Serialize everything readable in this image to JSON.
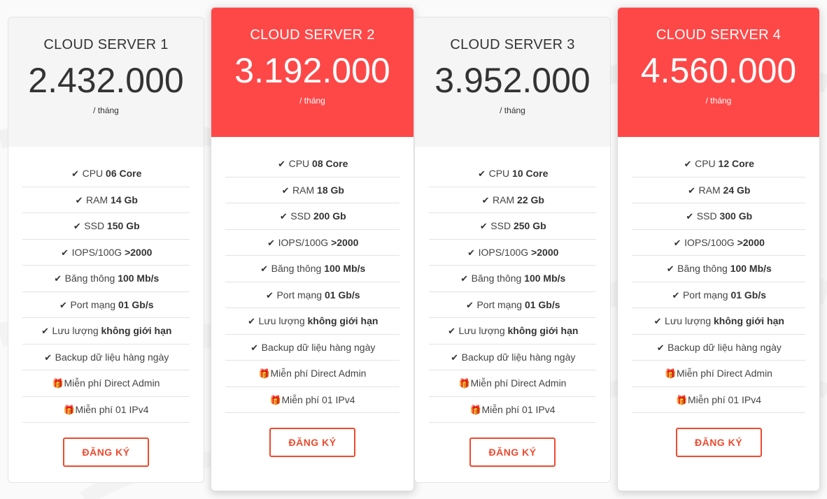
{
  "accent_color": "#fe4848",
  "button_color": "#ee4a2e",
  "plans": [
    {
      "title": "CLOUD SERVER 1",
      "price": "2.432.000",
      "period": "/ tháng",
      "featured": false,
      "features": [
        {
          "icon": "check-icon",
          "label": "CPU",
          "value": "06 Core"
        },
        {
          "icon": "check-icon",
          "label": "RAM",
          "value": "14 Gb"
        },
        {
          "icon": "check-icon",
          "label": "SSD",
          "value": "150 Gb"
        },
        {
          "icon": "check-icon",
          "label": "IOPS/100G",
          "value": ">2000"
        },
        {
          "icon": "check-icon",
          "label": "Băng thông",
          "value": "100 Mb/s"
        },
        {
          "icon": "check-icon",
          "label": "Port mạng",
          "value": "01 Gb/s"
        },
        {
          "icon": "check-icon",
          "label": "Lưu lượng",
          "value": "không giới hạn"
        },
        {
          "icon": "check-icon",
          "label": "Backup dữ liệu hàng ngày",
          "value": ""
        },
        {
          "icon": "gift-icon",
          "label": "Miễn phí Direct Admin",
          "value": ""
        },
        {
          "icon": "gift-icon",
          "label": "Miễn phí 01 IPv4",
          "value": ""
        }
      ],
      "button": "ĐĂNG KÝ"
    },
    {
      "title": "CLOUD SERVER 2",
      "price": "3.192.000",
      "period": "/ tháng",
      "featured": true,
      "features": [
        {
          "icon": "check-icon",
          "label": "CPU",
          "value": "08 Core"
        },
        {
          "icon": "check-icon",
          "label": "RAM",
          "value": "18 Gb"
        },
        {
          "icon": "check-icon",
          "label": "SSD",
          "value": "200 Gb"
        },
        {
          "icon": "check-icon",
          "label": "IOPS/100G",
          "value": ">2000"
        },
        {
          "icon": "check-icon",
          "label": "Băng thông",
          "value": "100 Mb/s"
        },
        {
          "icon": "check-icon",
          "label": "Port mạng",
          "value": "01 Gb/s"
        },
        {
          "icon": "check-icon",
          "label": "Lưu lượng",
          "value": "không giới hạn"
        },
        {
          "icon": "check-icon",
          "label": "Backup dữ liệu hàng ngày",
          "value": ""
        },
        {
          "icon": "gift-icon",
          "label": "Miễn phí Direct Admin",
          "value": ""
        },
        {
          "icon": "gift-icon",
          "label": "Miễn phí 01 IPv4",
          "value": ""
        }
      ],
      "button": "ĐĂNG KÝ"
    },
    {
      "title": "CLOUD SERVER 3",
      "price": "3.952.000",
      "period": "/ tháng",
      "featured": false,
      "features": [
        {
          "icon": "check-icon",
          "label": "CPU",
          "value": "10 Core"
        },
        {
          "icon": "check-icon",
          "label": "RAM",
          "value": "22 Gb"
        },
        {
          "icon": "check-icon",
          "label": "SSD",
          "value": "250 Gb"
        },
        {
          "icon": "check-icon",
          "label": "IOPS/100G",
          "value": ">2000"
        },
        {
          "icon": "check-icon",
          "label": "Băng thông",
          "value": "100 Mb/s"
        },
        {
          "icon": "check-icon",
          "label": "Port mạng",
          "value": "01 Gb/s"
        },
        {
          "icon": "check-icon",
          "label": "Lưu lượng",
          "value": "không giới hạn"
        },
        {
          "icon": "check-icon",
          "label": "Backup dữ liệu hàng ngày",
          "value": ""
        },
        {
          "icon": "gift-icon",
          "label": "Miễn phí Direct Admin",
          "value": ""
        },
        {
          "icon": "gift-icon",
          "label": "Miễn phí 01 IPv4",
          "value": ""
        }
      ],
      "button": "ĐĂNG KÝ"
    },
    {
      "title": "CLOUD SERVER 4",
      "price": "4.560.000",
      "period": "/ tháng",
      "featured": true,
      "features": [
        {
          "icon": "check-icon",
          "label": "CPU",
          "value": "12 Core"
        },
        {
          "icon": "check-icon",
          "label": "RAM",
          "value": "24 Gb"
        },
        {
          "icon": "check-icon",
          "label": "SSD",
          "value": "300 Gb"
        },
        {
          "icon": "check-icon",
          "label": "IOPS/100G",
          "value": ">2000"
        },
        {
          "icon": "check-icon",
          "label": "Băng thông",
          "value": "100 Mb/s"
        },
        {
          "icon": "check-icon",
          "label": "Port mạng",
          "value": "01 Gb/s"
        },
        {
          "icon": "check-icon",
          "label": "Lưu lượng",
          "value": "không giới hạn"
        },
        {
          "icon": "check-icon",
          "label": "Backup dữ liệu hàng ngày",
          "value": ""
        },
        {
          "icon": "gift-icon",
          "label": "Miễn phí Direct Admin",
          "value": ""
        },
        {
          "icon": "gift-icon",
          "label": "Miễn phí 01 IPv4",
          "value": ""
        }
      ],
      "button": "ĐĂNG KÝ"
    }
  ]
}
